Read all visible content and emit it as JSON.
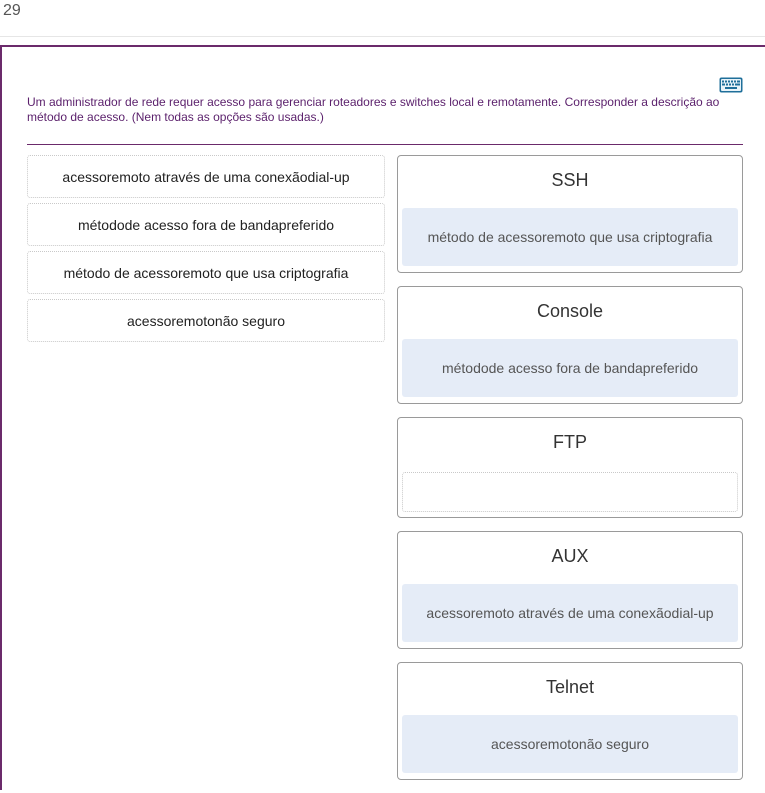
{
  "question_number": "29",
  "instructions": "Um administrador de rede requer acesso para gerenciar roteadores e switches local e remotamente. Corresponder a descrição ao método de acesso. (Nem todas as opções são usadas.)",
  "keyboard_icon": "keyboard-icon",
  "colors": {
    "accent": "#6b2a6b",
    "drop_fill": "#e5ecf7"
  },
  "options": [
    {
      "label": "acessoremoto através de uma conexãodial-up"
    },
    {
      "label": "métodode acesso fora de bandapreferido"
    },
    {
      "label": "método de acessoremoto que usa criptografia"
    },
    {
      "label": "acessoremotonão seguro"
    }
  ],
  "targets": [
    {
      "title": "SSH",
      "answer": "método de acessoremoto que usa criptografia"
    },
    {
      "title": "Console",
      "answer": "métodode acesso fora de bandapreferido"
    },
    {
      "title": "FTP",
      "answer": ""
    },
    {
      "title": "AUX",
      "answer": "acessoremoto através de uma conexãodial-up"
    },
    {
      "title": "Telnet",
      "answer": "acessoremotonão seguro"
    }
  ]
}
